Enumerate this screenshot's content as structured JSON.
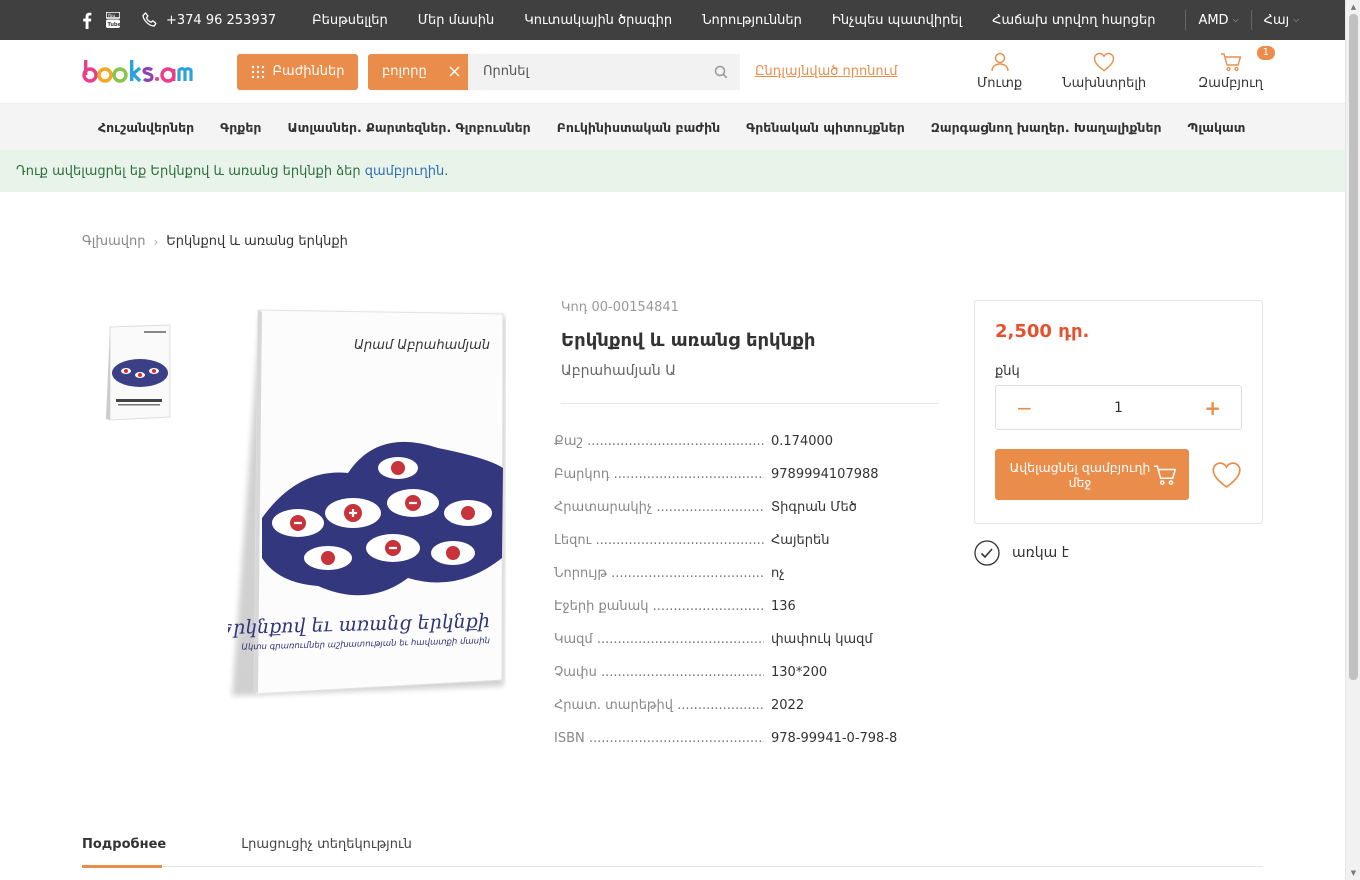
{
  "topbar": {
    "phone": "+374 96 253937",
    "links": [
      "Բեսթսելլեր",
      "Մեր մասին",
      "Կուտակային ծրագիր",
      "Նորություններ",
      "Ինչպես պատվիրել",
      "Հաճախ տրվող հարցեր"
    ],
    "currency": "AMD",
    "language": "Հայ"
  },
  "header": {
    "logo_text": "books.am",
    "categories_label": "Բաժիններ",
    "scope_label": "բոլորը",
    "search_placeholder": "Որոնել",
    "advanced_search": "Ընդլայնված որոնում",
    "login": "Մուտք",
    "favorites": "Նախնտրելի",
    "cart": "Զամբյուղ",
    "cart_count": "1"
  },
  "catnav": [
    "Հուշանվերներ",
    "Գրքեր",
    "Ատլասներ. Քարտեզներ. Գլոբուսներ",
    "Բուկինիստական բաժին",
    "Գրենական պիտույքներ",
    "Զարգացնող խաղեր. Խաղալիքներ",
    "Պլակատ"
  ],
  "alert": {
    "text": "Դուք ավելացրել եք Երկնքով և առանց երկնքի ձեր ",
    "link": "զամբյուղին",
    "end": "."
  },
  "breadcrumb": {
    "home": "Գլխավոր",
    "current": "Երկնքով և առանց երկնքի"
  },
  "cover": {
    "author": "Արամ Աբրահամյան",
    "title": "Երկնքով եւ առանց երկնքի",
    "subtitle": "Ակտս գրառումներ աշխատության եւ հավատքի մասին"
  },
  "product": {
    "code_label": "Կոդ",
    "code": "00-00154841",
    "title": "Երկնքով և առանց երկնքի",
    "author": "Աբրահամյան Ա",
    "specs": [
      {
        "k": "Քաշ",
        "v": "0.174000"
      },
      {
        "k": "Բարկոդ",
        "v": "9789994107988"
      },
      {
        "k": "Հրատարակիչ",
        "v": "Տիգրան Մեծ"
      },
      {
        "k": "Լեզու",
        "v": "Հայերեն"
      },
      {
        "k": "Նորույթ",
        "v": "ոչ"
      },
      {
        "k": "Էջերի քանակ",
        "v": "136"
      },
      {
        "k": "Կազմ",
        "v": "փափուկ կազմ"
      },
      {
        "k": "Չափս",
        "v": "130*200"
      },
      {
        "k": "Հրատ. տարեթիվ",
        "v": "2022"
      },
      {
        "k": "ISBN",
        "v": "978-99941-0-798-8"
      }
    ]
  },
  "buy": {
    "price": "2,500 դր.",
    "unit": "քնկ",
    "qty": "1",
    "add_label": "Ավելացնել զամբյուղի մեջ",
    "availability": "առկա է"
  },
  "tabs": [
    "Подробнее",
    "Լրացուցիչ տեղեկություն"
  ],
  "colors": {
    "accent": "#ea8d4b",
    "price": "#e5502e",
    "topbar": "#404040"
  }
}
